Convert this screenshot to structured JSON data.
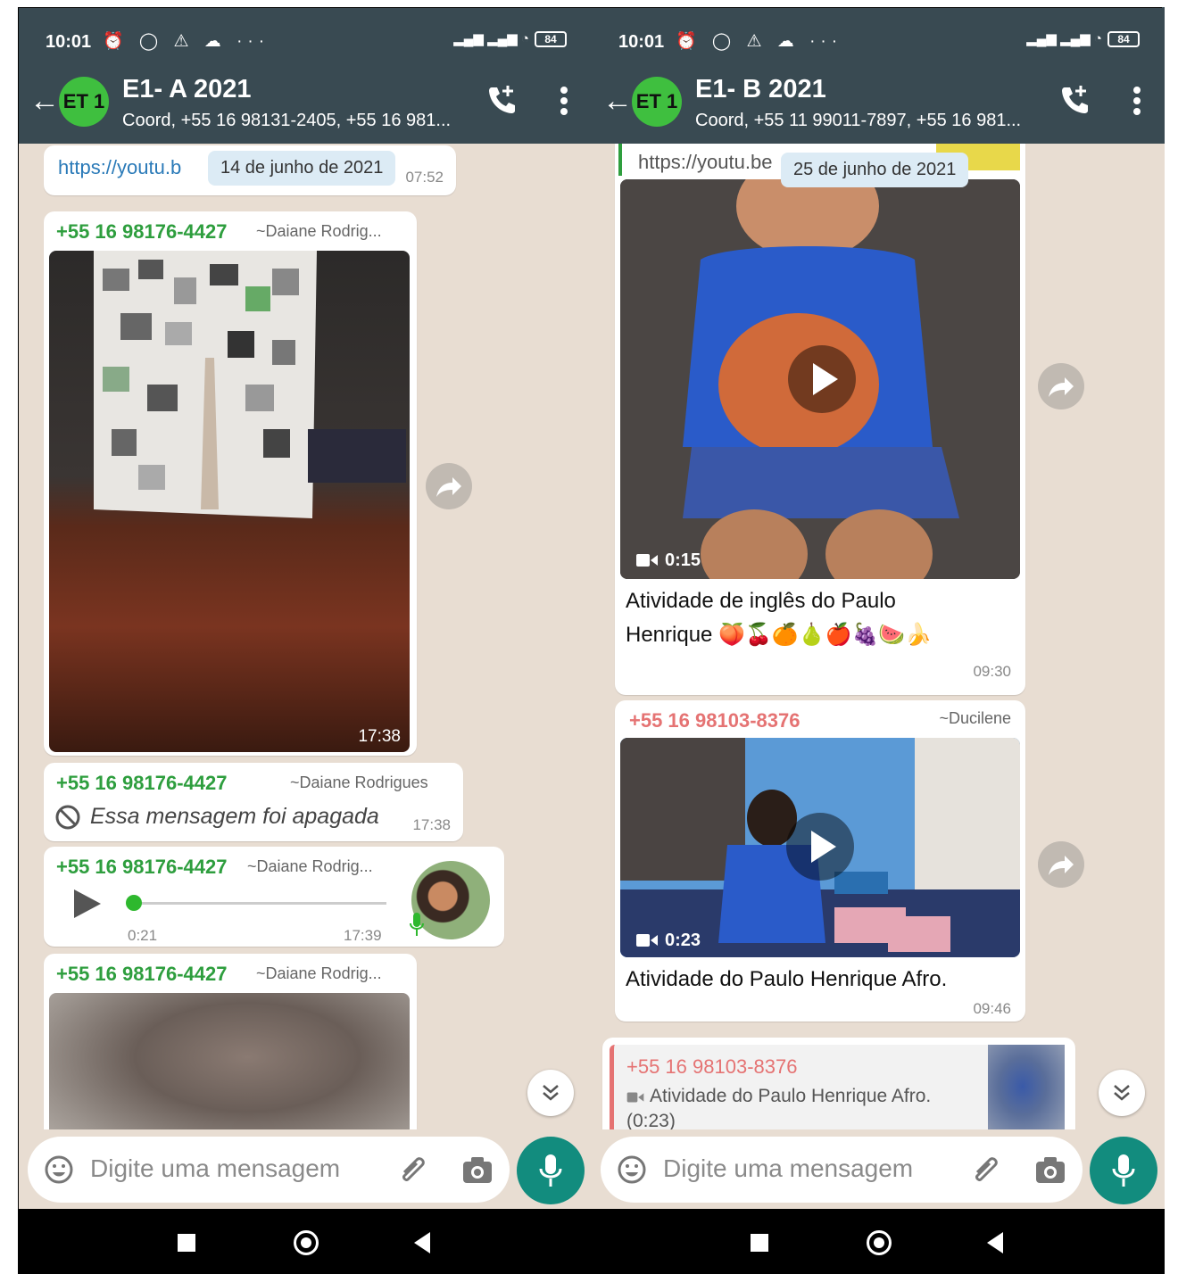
{
  "colors": {
    "header": "#394a52",
    "wa_green": "#128c7e",
    "sender_green": "#2e9e3e",
    "sender_red": "#e57373",
    "link": "#2a7ab8"
  },
  "left": {
    "status": {
      "time": "10:01",
      "battery": "84"
    },
    "header": {
      "avatar": "ET 1",
      "title": "E1- A 2021",
      "subtitle": "Coord, +55 16 98131-2405, +55 16 981..."
    },
    "chat": {
      "link_text": "https://youtu.b",
      "link_time": "07:52",
      "date_chip": "14 de junho de 2021",
      "msg1": {
        "sender": "+55 16 98176-4427",
        "alias": "~Daiane Rodrig...",
        "time": "17:38"
      },
      "msg2": {
        "sender": "+55 16 98176-4427",
        "alias": "~Daiane Rodrigues",
        "text": "Essa mensagem foi apagada",
        "time": "17:38"
      },
      "msg3": {
        "sender": "+55 16 98176-4427",
        "alias": "~Daiane Rodrig...",
        "duration": "0:21",
        "time": "17:39"
      },
      "msg4": {
        "sender": "+55 16 98176-4427",
        "alias": "~Daiane Rodrig..."
      }
    },
    "input": {
      "placeholder": "Digite uma mensagem"
    }
  },
  "right": {
    "status": {
      "time": "10:01",
      "battery": "84"
    },
    "header": {
      "avatar": "ET 1",
      "title": "E1- B 2021",
      "subtitle": "Coord, +55 11 99011-7897, +55 16 981..."
    },
    "chat": {
      "link_text": "https://youtu.be",
      "date_chip": "25 de junho de 2021",
      "msg1": {
        "duration": "0:15",
        "caption_line1": "Atividade de inglês do Paulo",
        "caption_line2": "Henrique 🍑🍒🍊🍐🍎🍇🍉🍌",
        "time": "09:30"
      },
      "msg2": {
        "sender": "+55 16 98103-8376",
        "alias": "~Ducilene",
        "duration": "0:23",
        "caption": "Atividade do Paulo Henrique Afro.",
        "time": "09:46"
      },
      "msg3": {
        "reply_sender": "+55 16 98103-8376",
        "reply_line1": "Atividade do Paulo Henrique Afro.",
        "reply_line2": "(0:23)"
      }
    },
    "input": {
      "placeholder": "Digite uma mensagem"
    }
  }
}
